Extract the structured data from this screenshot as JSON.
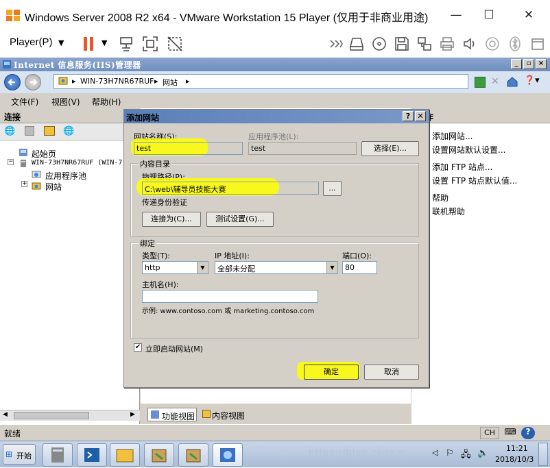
{
  "vm": {
    "title": "Windows Server 2008 R2 x64 - VMware Workstation 15 Player (仅用于非商业用途)",
    "player_menu": "Player(P)",
    "minimize": "—",
    "maximize": "☐",
    "close": "✕"
  },
  "iis": {
    "title": "Internet 信息服务(IIS)管理器",
    "breadcrumb": [
      "WIN-73H7NR67RUF",
      "网站"
    ],
    "menu": [
      "文件(F)",
      "视图(V)",
      "帮助(H)"
    ]
  },
  "connections": {
    "header": "连接",
    "tree": [
      "起始页",
      "WIN-73H7NR67RUF (WIN-7",
      "应用程序池",
      "网站"
    ]
  },
  "actions": {
    "header": "作",
    "items": [
      "添加网站...",
      "设置网站默认设置...",
      "添加 FTP 站点...",
      "设置 FTP 站点默认值...",
      "帮助",
      "联机帮助"
    ]
  },
  "view_tabs": [
    "功能视图",
    "内容视图"
  ],
  "status": "就绪",
  "dialog": {
    "title": "添加网站",
    "site_name_label": "网站名称(S):",
    "site_name_value": "test",
    "app_pool_label": "应用程序池(L):",
    "app_pool_value": "test",
    "select_button": "选择(E)...",
    "content_dir_label": "内容目录",
    "physical_path_label": "物理路径(P):",
    "physical_path_value": "C:\\web\\辅导员技能大赛",
    "browse_button": "...",
    "pass_auth_label": "传递身份验证",
    "connect_as_button": "连接为(C)...",
    "test_settings_button": "测试设置(G)...",
    "binding_label": "绑定",
    "type_label": "类型(T):",
    "type_value": "http",
    "ip_label": "IP 地址(I):",
    "ip_value": "全部未分配",
    "port_label": "端口(O):",
    "port_value": "80",
    "hostname_label": "主机名(H):",
    "hostname_value": "",
    "example_text": "示例: www.contoso.com 或 marketing.contoso.com",
    "start_now_label": "立即启动网站(M)",
    "start_now_checked": true,
    "ok_button": "确定",
    "cancel_button": "取消",
    "help_button": "?",
    "close_button": "✕"
  },
  "taskbar": {
    "start": "开始",
    "lang": "CH",
    "time": "11:21",
    "date": "2018/10/3",
    "watermark": "https://blog.csdn.n"
  },
  "colors": {
    "highlight": "#ffff00",
    "iis_title": "#6f8fbf",
    "dialog_bg": "#d4d0c8"
  }
}
